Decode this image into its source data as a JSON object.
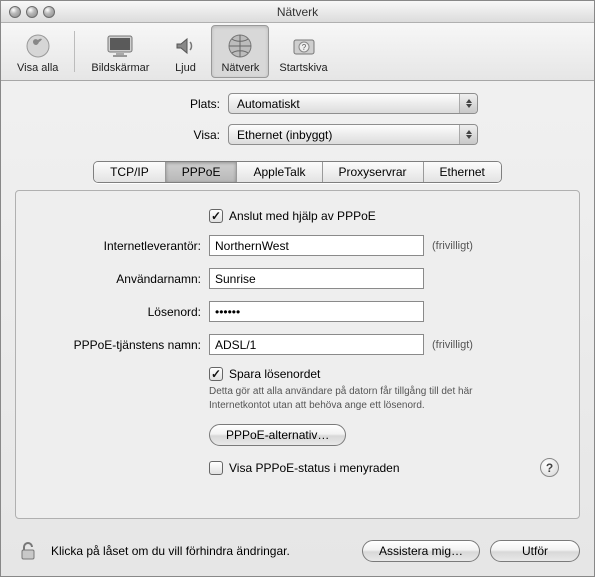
{
  "window": {
    "title": "Nätverk"
  },
  "toolbar": {
    "items": [
      {
        "label": "Visa alla"
      },
      {
        "label": "Bildskärmar"
      },
      {
        "label": "Ljud"
      },
      {
        "label": "Nätverk"
      },
      {
        "label": "Startskiva"
      }
    ]
  },
  "selectors": {
    "plats_label": "Plats:",
    "plats_value": "Automatiskt",
    "visa_label": "Visa:",
    "visa_value": "Ethernet (inbyggt)"
  },
  "tabs": {
    "items": [
      "TCP/IP",
      "PPPoE",
      "AppleTalk",
      "Proxyservrar",
      "Ethernet"
    ],
    "active": "PPPoE"
  },
  "pppoe": {
    "connect_checkbox_label": "Anslut med hjälp av PPPoE",
    "isp_label": "Internetleverantör:",
    "isp_value": "NorthernWest",
    "isp_hint": "(frivilligt)",
    "user_label": "Användarnamn:",
    "user_value": "Sunrise",
    "pass_label": "Lösenord:",
    "pass_value": "••••••",
    "service_label": "PPPoE-tjänstens namn:",
    "service_value": "ADSL/1",
    "service_hint": "(frivilligt)",
    "save_pass_label": "Spara lösenordet",
    "save_pass_note": "Detta gör att alla användare på datorn får tillgång till det här Internetkontot utan att behöva ange ett lösenord.",
    "options_button": "PPPoE-alternativ…",
    "show_status_label": "Visa PPPoE-status i menyraden"
  },
  "footer": {
    "lock_text": "Klicka på låset om du vill förhindra ändringar.",
    "assist_button": "Assistera mig…",
    "apply_button": "Utför"
  }
}
